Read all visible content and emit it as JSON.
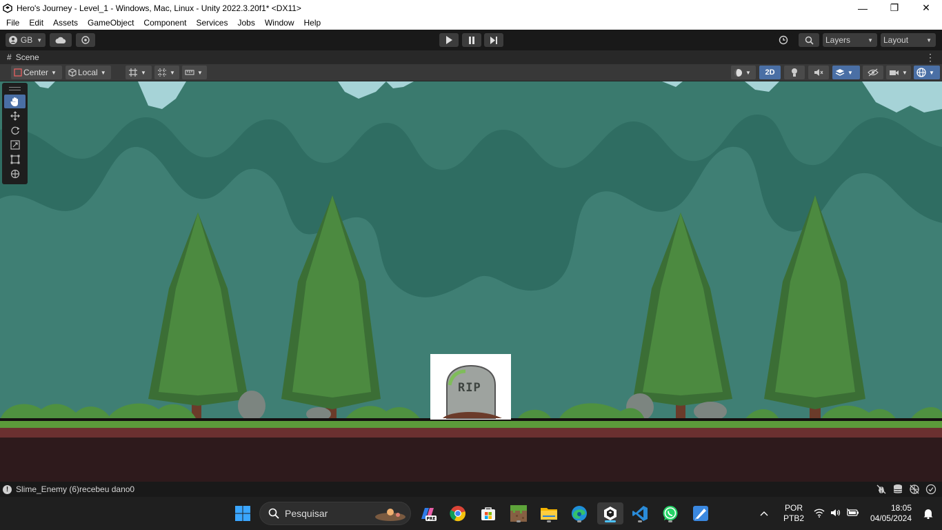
{
  "window": {
    "title": "Hero's Journey - Level_1 - Windows, Mac, Linux - Unity 2022.3.20f1* <DX11>",
    "minimize": "—",
    "restore": "❐",
    "close": "✕"
  },
  "menu": [
    "File",
    "Edit",
    "Assets",
    "GameObject",
    "Component",
    "Services",
    "Jobs",
    "Window",
    "Help"
  ],
  "toolbar": {
    "account_label": "GB",
    "layers_label": "Layers",
    "layout_label": "Layout"
  },
  "scene_tab": {
    "hash": "#",
    "label": "Scene",
    "more": "⋮"
  },
  "scene_toolbar": {
    "pivot_label": "Center",
    "space_label": "Local",
    "mode_2d_label": "2D"
  },
  "scene": {
    "tombstone_text": "RIP",
    "colors": {
      "background": "#3f7f74",
      "canopy": "#2e6d62",
      "sky": "#a6d3d7",
      "tree": "#3b6e35",
      "ground": "#2e1a1c"
    }
  },
  "statusbar": {
    "icon": "!",
    "message": "Slime_Enemy (6)recebeu dano0"
  },
  "taskbar": {
    "search_placeholder": "Pesquisar",
    "lang_line1": "POR",
    "lang_line2": "PTB2",
    "time": "18:05",
    "date": "04/05/2024",
    "tray_chevron": "^"
  }
}
